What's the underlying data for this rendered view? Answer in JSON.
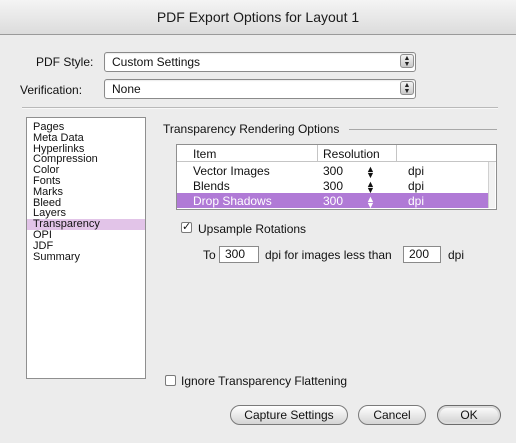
{
  "window": {
    "title": "PDF Export Options for Layout 1"
  },
  "pdf_style": {
    "label": "PDF Style:",
    "value": "Custom Settings"
  },
  "verification": {
    "label": "Verification:",
    "value": "None"
  },
  "sidebar": {
    "items": [
      {
        "label": "Pages"
      },
      {
        "label": "Meta Data"
      },
      {
        "label": "Hyperlinks"
      },
      {
        "label": "Compression"
      },
      {
        "label": "Color"
      },
      {
        "label": "Fonts"
      },
      {
        "label": "Marks"
      },
      {
        "label": "Bleed"
      },
      {
        "label": "Layers"
      },
      {
        "label": "Transparency",
        "selected": true
      },
      {
        "label": "OPI"
      },
      {
        "label": "JDF"
      },
      {
        "label": "Summary"
      }
    ]
  },
  "transparency": {
    "group_title": "Transparency Rendering Options",
    "table": {
      "headers": [
        "Item",
        "Resolution"
      ],
      "rows": [
        {
          "item": "Vector Images",
          "resolution": "300",
          "unit": "dpi"
        },
        {
          "item": "Blends",
          "resolution": "300",
          "unit": "dpi"
        },
        {
          "item": "Drop Shadows",
          "resolution": "300",
          "unit": "dpi",
          "selected": true
        }
      ]
    },
    "upsample": {
      "label": "Upsample Rotations",
      "checked": true,
      "to_label": "To",
      "dpi_value": "300",
      "middle_label": "dpi for images less than",
      "threshold_value": "200",
      "unit": "dpi"
    },
    "ignore_flattening": {
      "label": "Ignore Transparency Flattening",
      "checked": false
    }
  },
  "buttons": {
    "capture": "Capture Settings",
    "cancel": "Cancel",
    "ok": "OK"
  }
}
